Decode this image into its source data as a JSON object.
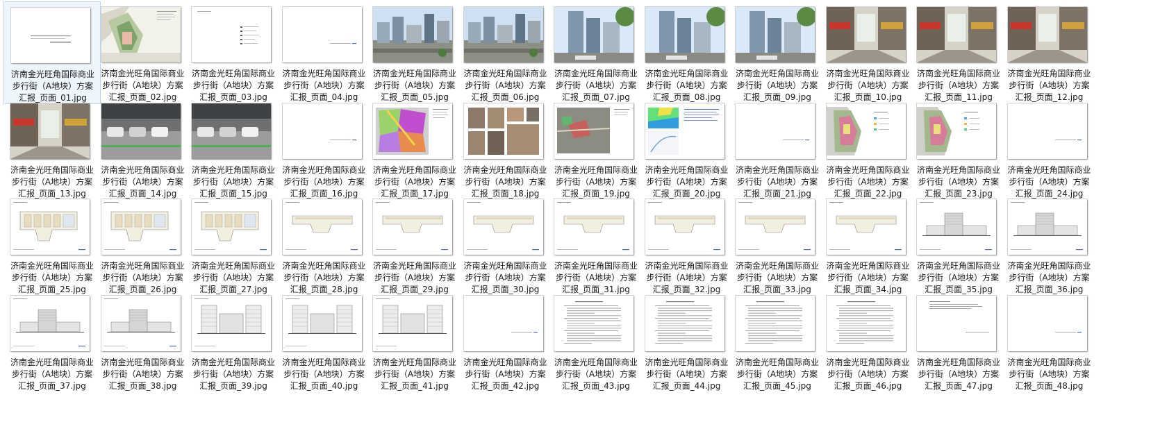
{
  "files": [
    {
      "lines": [
        "济南金光旺角国际商业",
        "步行街（A地块）方案",
        "汇报_页面_01.jpg"
      ],
      "kind": "title",
      "selected": true
    },
    {
      "lines": [
        "济南金光旺角国际商业",
        "步行街（A地块）方案",
        "汇报_页面_02.jpg"
      ],
      "kind": "siteplan"
    },
    {
      "lines": [
        "济南金光旺角国际商业",
        "步行街（A地块）方案",
        "汇报_页面_03.jpg"
      ],
      "kind": "contents"
    },
    {
      "lines": [
        "济南金光旺角国际商业",
        "步行街（A地块）方案",
        "汇报_页面_04.jpg"
      ],
      "kind": "section"
    },
    {
      "lines": [
        "济南金光旺角国际商业",
        "步行街（A地块）方案",
        "汇报_页面_05.jpg"
      ],
      "kind": "photo-city"
    },
    {
      "lines": [
        "济南金光旺角国际商业",
        "步行街（A地块）方案",
        "汇报_页面_06.jpg"
      ],
      "kind": "photo-city"
    },
    {
      "lines": [
        "济南金光旺角国际商业",
        "步行街（A地块）方案",
        "汇报_页面_07.jpg"
      ],
      "kind": "photo-tower"
    },
    {
      "lines": [
        "济南金光旺角国际商业",
        "步行街（A地块）方案",
        "汇报_页面_08.jpg"
      ],
      "kind": "photo-tower"
    },
    {
      "lines": [
        "济南金光旺角国际商业",
        "步行街（A地块）方案",
        "汇报_页面_09.jpg"
      ],
      "kind": "photo-tower"
    },
    {
      "lines": [
        "济南金光旺角国际商业",
        "步行街（A地块）方案",
        "汇报_页面_10.jpg"
      ],
      "kind": "photo-street"
    },
    {
      "lines": [
        "济南金光旺角国际商业",
        "步行街（A地块）方案",
        "汇报_页面_11.jpg"
      ],
      "kind": "photo-street"
    },
    {
      "lines": [
        "济南金光旺角国际商业",
        "步行街（A地块）方案",
        "汇报_页面_12.jpg"
      ],
      "kind": "photo-street"
    },
    {
      "lines": [
        "济南金光旺角国际商业",
        "步行街（A地块）方案",
        "汇报_页面_13.jpg"
      ],
      "kind": "photo-street"
    },
    {
      "lines": [
        "济南金光旺角国际商业",
        "步行街（A地块）方案",
        "汇报_页面_14.jpg"
      ],
      "kind": "photo-garage"
    },
    {
      "lines": [
        "济南金光旺角国际商业",
        "步行街（A地块）方案",
        "汇报_页面_15.jpg"
      ],
      "kind": "photo-garage"
    },
    {
      "lines": [
        "济南金光旺角国际商业",
        "步行街（A地块）方案",
        "汇报_页面_16.jpg"
      ],
      "kind": "section"
    },
    {
      "lines": [
        "济南金光旺角国际商业",
        "步行街（A地块）方案",
        "汇报_页面_17.jpg"
      ],
      "kind": "map-color"
    },
    {
      "lines": [
        "济南金光旺角国际商业",
        "步行街（A地块）方案",
        "汇报_页面_18.jpg"
      ],
      "kind": "photo-collage"
    },
    {
      "lines": [
        "济南金光旺角国际商业",
        "步行街（A地块）方案",
        "汇报_页面_19.jpg"
      ],
      "kind": "map-aerial"
    },
    {
      "lines": [
        "济南金光旺角国际商业",
        "步行街（A地块）方案",
        "汇报_页面_20.jpg"
      ],
      "kind": "map-terrain"
    },
    {
      "lines": [
        "济南金光旺角国际商业",
        "步行街（A地块）方案",
        "汇报_页面_21.jpg"
      ],
      "kind": "section"
    },
    {
      "lines": [
        "济南金光旺角国际商业",
        "步行街（A地块）方案",
        "汇报_页面_22.jpg"
      ],
      "kind": "siteplan2"
    },
    {
      "lines": [
        "济南金光旺角国际商业",
        "步行街（A地块）方案",
        "汇报_页面_23.jpg"
      ],
      "kind": "siteplan2"
    },
    {
      "lines": [
        "济南金光旺角国际商业",
        "步行街（A地块）方案",
        "汇报_页面_24.jpg"
      ],
      "kind": "section"
    },
    {
      "lines": [
        "济南金光旺角国际商业",
        "步行街（A地块）方案",
        "汇报_页面_25.jpg"
      ],
      "kind": "floorplan"
    },
    {
      "lines": [
        "济南金光旺角国际商业",
        "步行街（A地块）方案",
        "汇报_页面_26.jpg"
      ],
      "kind": "floorplan"
    },
    {
      "lines": [
        "济南金光旺角国际商业",
        "步行街（A地块）方案",
        "汇报_页面_27.jpg"
      ],
      "kind": "floorplan"
    },
    {
      "lines": [
        "济南金光旺角国际商业",
        "步行街（A地块）方案",
        "汇报_页面_28.jpg"
      ],
      "kind": "floorplan-thin"
    },
    {
      "lines": [
        "济南金光旺角国际商业",
        "步行街（A地块）方案",
        "汇报_页面_29.jpg"
      ],
      "kind": "floorplan-thin"
    },
    {
      "lines": [
        "济南金光旺角国际商业",
        "步行街（A地块）方案",
        "汇报_页面_30.jpg"
      ],
      "kind": "floorplan-thin"
    },
    {
      "lines": [
        "济南金光旺角国际商业",
        "步行街（A地块）方案",
        "汇报_页面_31.jpg"
      ],
      "kind": "floorplan-thin"
    },
    {
      "lines": [
        "济南金光旺角国际商业",
        "步行街（A地块）方案",
        "汇报_页面_32.jpg"
      ],
      "kind": "floorplan-thin"
    },
    {
      "lines": [
        "济南金光旺角国际商业",
        "步行街（A地块）方案",
        "汇报_页面_33.jpg"
      ],
      "kind": "floorplan-thin"
    },
    {
      "lines": [
        "济南金光旺角国际商业",
        "步行街（A地块）方案",
        "汇报_页面_34.jpg"
      ],
      "kind": "floorplan-thin"
    },
    {
      "lines": [
        "济南金光旺角国际商业",
        "步行街（A地块）方案",
        "汇报_页面_35.jpg"
      ],
      "kind": "elevation"
    },
    {
      "lines": [
        "济南金光旺角国际商业",
        "步行街（A地块）方案",
        "汇报_页面_36.jpg"
      ],
      "kind": "elevation"
    },
    {
      "lines": [
        "济南金光旺角国际商业",
        "步行街（A地块）方案",
        "汇报_页面_37.jpg"
      ],
      "kind": "elevation"
    },
    {
      "lines": [
        "济南金光旺角国际商业",
        "步行街（A地块）方案",
        "汇报_页面_38.jpg"
      ],
      "kind": "elevation"
    },
    {
      "lines": [
        "济南金光旺角国际商业",
        "步行街（A地块）方案",
        "汇报_页面_39.jpg"
      ],
      "kind": "elevation-tall"
    },
    {
      "lines": [
        "济南金光旺角国际商业",
        "步行街（A地块）方案",
        "汇报_页面_40.jpg"
      ],
      "kind": "elevation-tall"
    },
    {
      "lines": [
        "济南金光旺角国际商业",
        "步行街（A地块）方案",
        "汇报_页面_41.jpg"
      ],
      "kind": "elevation-tall"
    },
    {
      "lines": [
        "济南金光旺角国际商业",
        "步行街（A地块）方案",
        "汇报_页面_42.jpg"
      ],
      "kind": "section"
    },
    {
      "lines": [
        "济南金光旺角国际商业",
        "步行街（A地块）方案",
        "汇报_页面_43.jpg"
      ],
      "kind": "text"
    },
    {
      "lines": [
        "济南金光旺角国际商业",
        "步行街（A地块）方案",
        "汇报_页面_44.jpg"
      ],
      "kind": "text"
    },
    {
      "lines": [
        "济南金光旺角国际商业",
        "步行街（A地块）方案",
        "汇报_页面_45.jpg"
      ],
      "kind": "text"
    },
    {
      "lines": [
        "济南金光旺角国际商业",
        "步行街（A地块）方案",
        "汇报_页面_46.jpg"
      ],
      "kind": "text"
    },
    {
      "lines": [
        "济南金光旺角国际商业",
        "步行街（A地块）方案",
        "汇报_页面_47.jpg"
      ],
      "kind": "text-short"
    },
    {
      "lines": [
        "济南金光旺角国际商业",
        "步行街（A地块）方案",
        "汇报_页面_48.jpg"
      ],
      "kind": "section"
    }
  ]
}
